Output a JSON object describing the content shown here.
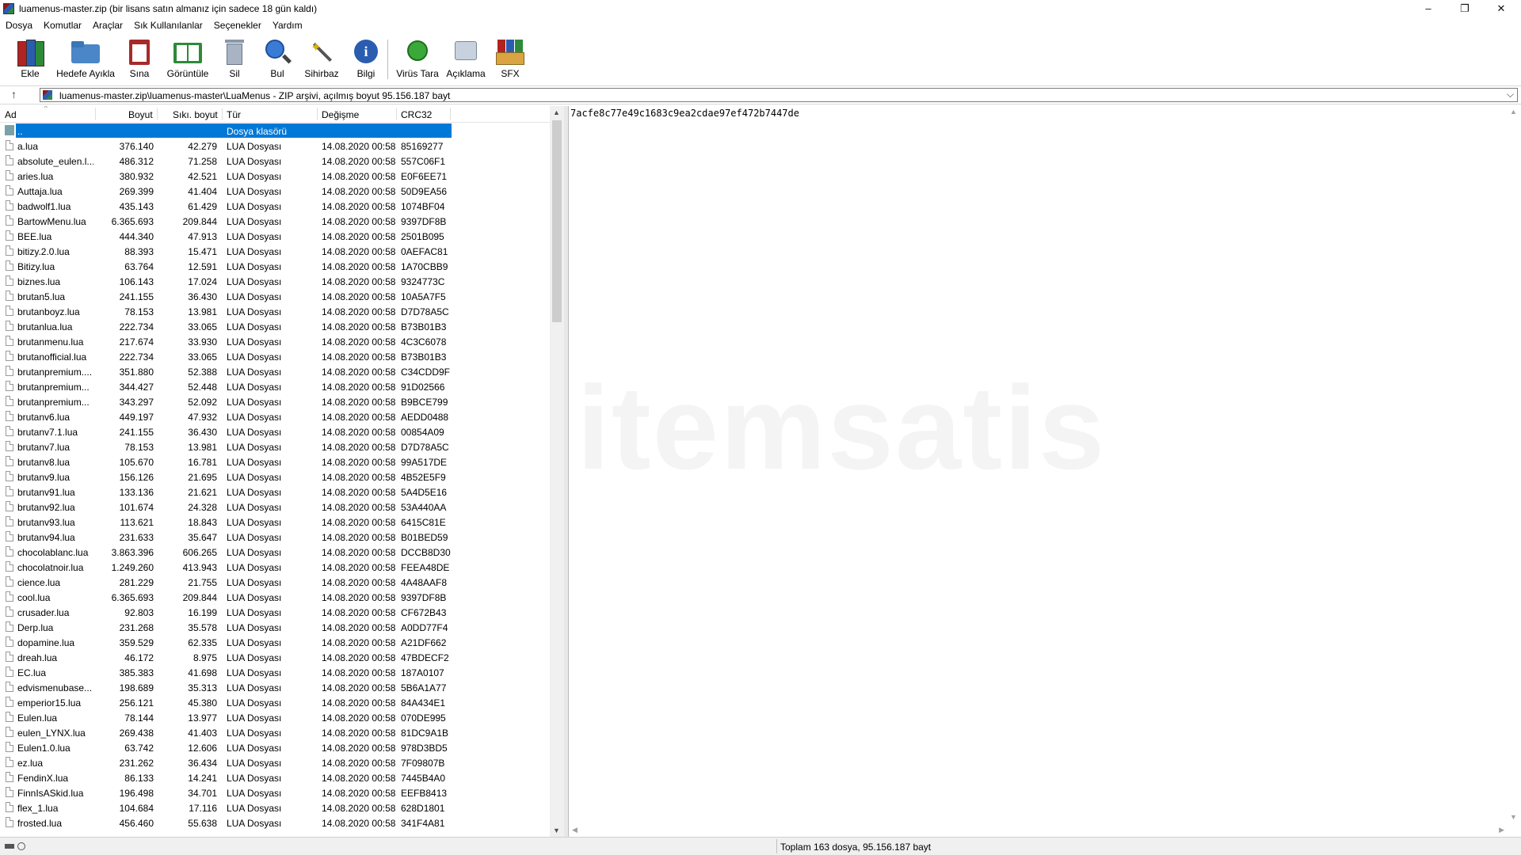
{
  "window": {
    "title": "luamenus-master.zip (bir lisans satın almanız için sadece 18 gün kaldı)",
    "minimize": "–",
    "restore": "❐",
    "close": "✕"
  },
  "menu": [
    "Dosya",
    "Komutlar",
    "Araçlar",
    "Sık Kullanılanlar",
    "Seçenekler",
    "Yardım"
  ],
  "toolbar": [
    {
      "label": "Ekle",
      "icon": "books-add-icon"
    },
    {
      "label": "Hedefe Ayıkla",
      "icon": "folder-extract-icon"
    },
    {
      "label": "Sına",
      "icon": "test-clipboard-icon"
    },
    {
      "label": "Görüntüle",
      "icon": "view-book-icon"
    },
    {
      "label": "Sil",
      "icon": "trash-icon"
    },
    {
      "label": "Bul",
      "icon": "magnifier-icon"
    },
    {
      "label": "Sihirbaz",
      "icon": "wand-icon"
    },
    {
      "label": "Bilgi",
      "icon": "info-icon"
    },
    {
      "label": "Virüs Tara",
      "icon": "virus-scan-icon"
    },
    {
      "label": "Açıklama",
      "icon": "comment-icon"
    },
    {
      "label": "SFX",
      "icon": "sfx-box-icon"
    }
  ],
  "address": {
    "path": "luamenus-master.zip\\luamenus-master\\LuaMenus - ZIP arşivi, açılmış boyut 95.156.187 bayt"
  },
  "columns": {
    "name": "Ad",
    "size": "Boyut",
    "packed": "Sıkı. boyut",
    "type": "Tür",
    "modified": "Değişme",
    "crc": "CRC32"
  },
  "folder_row": {
    "name": "..",
    "type": "Dosya klasörü"
  },
  "files": [
    {
      "name": "a.lua",
      "size": "376.140",
      "packed": "42.279",
      "type": "LUA Dosyası",
      "modified": "14.08.2020 00:58",
      "crc": "85169277"
    },
    {
      "name": "absolute_eulen.l...",
      "size": "486.312",
      "packed": "71.258",
      "type": "LUA Dosyası",
      "modified": "14.08.2020 00:58",
      "crc": "557C06F1"
    },
    {
      "name": "aries.lua",
      "size": "380.932",
      "packed": "42.521",
      "type": "LUA Dosyası",
      "modified": "14.08.2020 00:58",
      "crc": "E0F6EE71"
    },
    {
      "name": "Auttaja.lua",
      "size": "269.399",
      "packed": "41.404",
      "type": "LUA Dosyası",
      "modified": "14.08.2020 00:58",
      "crc": "50D9EA56"
    },
    {
      "name": "badwolf1.lua",
      "size": "435.143",
      "packed": "61.429",
      "type": "LUA Dosyası",
      "modified": "14.08.2020 00:58",
      "crc": "1074BF04"
    },
    {
      "name": "BartowMenu.lua",
      "size": "6.365.693",
      "packed": "209.844",
      "type": "LUA Dosyası",
      "modified": "14.08.2020 00:58",
      "crc": "9397DF8B"
    },
    {
      "name": "BEE.lua",
      "size": "444.340",
      "packed": "47.913",
      "type": "LUA Dosyası",
      "modified": "14.08.2020 00:58",
      "crc": "2501B095"
    },
    {
      "name": "bitizy.2.0.lua",
      "size": "88.393",
      "packed": "15.471",
      "type": "LUA Dosyası",
      "modified": "14.08.2020 00:58",
      "crc": "0AEFAC81"
    },
    {
      "name": "Bitizy.lua",
      "size": "63.764",
      "packed": "12.591",
      "type": "LUA Dosyası",
      "modified": "14.08.2020 00:58",
      "crc": "1A70CBB9"
    },
    {
      "name": "biznes.lua",
      "size": "106.143",
      "packed": "17.024",
      "type": "LUA Dosyası",
      "modified": "14.08.2020 00:58",
      "crc": "9324773C"
    },
    {
      "name": "brutan5.lua",
      "size": "241.155",
      "packed": "36.430",
      "type": "LUA Dosyası",
      "modified": "14.08.2020 00:58",
      "crc": "10A5A7F5"
    },
    {
      "name": "brutanboyz.lua",
      "size": "78.153",
      "packed": "13.981",
      "type": "LUA Dosyası",
      "modified": "14.08.2020 00:58",
      "crc": "D7D78A5C"
    },
    {
      "name": "brutanlua.lua",
      "size": "222.734",
      "packed": "33.065",
      "type": "LUA Dosyası",
      "modified": "14.08.2020 00:58",
      "crc": "B73B01B3"
    },
    {
      "name": "brutanmenu.lua",
      "size": "217.674",
      "packed": "33.930",
      "type": "LUA Dosyası",
      "modified": "14.08.2020 00:58",
      "crc": "4C3C6078"
    },
    {
      "name": "brutanofficial.lua",
      "size": "222.734",
      "packed": "33.065",
      "type": "LUA Dosyası",
      "modified": "14.08.2020 00:58",
      "crc": "B73B01B3"
    },
    {
      "name": "brutanpremium....",
      "size": "351.880",
      "packed": "52.388",
      "type": "LUA Dosyası",
      "modified": "14.08.2020 00:58",
      "crc": "C34CDD9F"
    },
    {
      "name": "brutanpremium...",
      "size": "344.427",
      "packed": "52.448",
      "type": "LUA Dosyası",
      "modified": "14.08.2020 00:58",
      "crc": "91D02566"
    },
    {
      "name": "brutanpremium...",
      "size": "343.297",
      "packed": "52.092",
      "type": "LUA Dosyası",
      "modified": "14.08.2020 00:58",
      "crc": "B9BCE799"
    },
    {
      "name": "brutanv6.lua",
      "size": "449.197",
      "packed": "47.932",
      "type": "LUA Dosyası",
      "modified": "14.08.2020 00:58",
      "crc": "AEDD0488"
    },
    {
      "name": "brutanv7.1.lua",
      "size": "241.155",
      "packed": "36.430",
      "type": "LUA Dosyası",
      "modified": "14.08.2020 00:58",
      "crc": "00854A09"
    },
    {
      "name": "brutanv7.lua",
      "size": "78.153",
      "packed": "13.981",
      "type": "LUA Dosyası",
      "modified": "14.08.2020 00:58",
      "crc": "D7D78A5C"
    },
    {
      "name": "brutanv8.lua",
      "size": "105.670",
      "packed": "16.781",
      "type": "LUA Dosyası",
      "modified": "14.08.2020 00:58",
      "crc": "99A517DE"
    },
    {
      "name": "brutanv9.lua",
      "size": "156.126",
      "packed": "21.695",
      "type": "LUA Dosyası",
      "modified": "14.08.2020 00:58",
      "crc": "4B52E5F9"
    },
    {
      "name": "brutanv91.lua",
      "size": "133.136",
      "packed": "21.621",
      "type": "LUA Dosyası",
      "modified": "14.08.2020 00:58",
      "crc": "5A4D5E16"
    },
    {
      "name": "brutanv92.lua",
      "size": "101.674",
      "packed": "24.328",
      "type": "LUA Dosyası",
      "modified": "14.08.2020 00:58",
      "crc": "53A440AA"
    },
    {
      "name": "brutanv93.lua",
      "size": "113.621",
      "packed": "18.843",
      "type": "LUA Dosyası",
      "modified": "14.08.2020 00:58",
      "crc": "6415C81E"
    },
    {
      "name": "brutanv94.lua",
      "size": "231.633",
      "packed": "35.647",
      "type": "LUA Dosyası",
      "modified": "14.08.2020 00:58",
      "crc": "B01BED59"
    },
    {
      "name": "chocolablanc.lua",
      "size": "3.863.396",
      "packed": "606.265",
      "type": "LUA Dosyası",
      "modified": "14.08.2020 00:58",
      "crc": "DCCB8D30"
    },
    {
      "name": "chocolatnoir.lua",
      "size": "1.249.260",
      "packed": "413.943",
      "type": "LUA Dosyası",
      "modified": "14.08.2020 00:58",
      "crc": "FEEA48DE"
    },
    {
      "name": "cience.lua",
      "size": "281.229",
      "packed": "21.755",
      "type": "LUA Dosyası",
      "modified": "14.08.2020 00:58",
      "crc": "4A48AAF8"
    },
    {
      "name": "cool.lua",
      "size": "6.365.693",
      "packed": "209.844",
      "type": "LUA Dosyası",
      "modified": "14.08.2020 00:58",
      "crc": "9397DF8B"
    },
    {
      "name": "crusader.lua",
      "size": "92.803",
      "packed": "16.199",
      "type": "LUA Dosyası",
      "modified": "14.08.2020 00:58",
      "crc": "CF672B43"
    },
    {
      "name": "Derp.lua",
      "size": "231.268",
      "packed": "35.578",
      "type": "LUA Dosyası",
      "modified": "14.08.2020 00:58",
      "crc": "A0DD77F4"
    },
    {
      "name": "dopamine.lua",
      "size": "359.529",
      "packed": "62.335",
      "type": "LUA Dosyası",
      "modified": "14.08.2020 00:58",
      "crc": "A21DF662"
    },
    {
      "name": "dreah.lua",
      "size": "46.172",
      "packed": "8.975",
      "type": "LUA Dosyası",
      "modified": "14.08.2020 00:58",
      "crc": "47BDECF2"
    },
    {
      "name": "EC.lua",
      "size": "385.383",
      "packed": "41.698",
      "type": "LUA Dosyası",
      "modified": "14.08.2020 00:58",
      "crc": "187A0107"
    },
    {
      "name": "edvismenubase...",
      "size": "198.689",
      "packed": "35.313",
      "type": "LUA Dosyası",
      "modified": "14.08.2020 00:58",
      "crc": "5B6A1A77"
    },
    {
      "name": "emperior15.lua",
      "size": "256.121",
      "packed": "45.380",
      "type": "LUA Dosyası",
      "modified": "14.08.2020 00:58",
      "crc": "84A434E1"
    },
    {
      "name": "Eulen.lua",
      "size": "78.144",
      "packed": "13.977",
      "type": "LUA Dosyası",
      "modified": "14.08.2020 00:58",
      "crc": "070DE995"
    },
    {
      "name": "eulen_LYNX.lua",
      "size": "269.438",
      "packed": "41.403",
      "type": "LUA Dosyası",
      "modified": "14.08.2020 00:58",
      "crc": "81DC9A1B"
    },
    {
      "name": "Eulen1.0.lua",
      "size": "63.742",
      "packed": "12.606",
      "type": "LUA Dosyası",
      "modified": "14.08.2020 00:58",
      "crc": "978D3BD5"
    },
    {
      "name": "ez.lua",
      "size": "231.262",
      "packed": "36.434",
      "type": "LUA Dosyası",
      "modified": "14.08.2020 00:58",
      "crc": "7F09807B"
    },
    {
      "name": "FendinX.lua",
      "size": "86.133",
      "packed": "14.241",
      "type": "LUA Dosyası",
      "modified": "14.08.2020 00:58",
      "crc": "7445B4A0"
    },
    {
      "name": "FinnIsASkid.lua",
      "size": "196.498",
      "packed": "34.701",
      "type": "LUA Dosyası",
      "modified": "14.08.2020 00:58",
      "crc": "EEFB8413"
    },
    {
      "name": "flex_1.lua",
      "size": "104.684",
      "packed": "17.116",
      "type": "LUA Dosyası",
      "modified": "14.08.2020 00:58",
      "crc": "628D1801"
    },
    {
      "name": "frosted.lua",
      "size": "456.460",
      "packed": "55.638",
      "type": "LUA Dosyası",
      "modified": "14.08.2020 00:58",
      "crc": "341F4A81"
    }
  ],
  "viewer": {
    "text": "7acfe8c77e49c1683c9ea2cdae97ef472b7447de",
    "watermark": "itemsatis"
  },
  "status": {
    "text": "Toplam 163 dosya, 95.156.187 bayt"
  }
}
